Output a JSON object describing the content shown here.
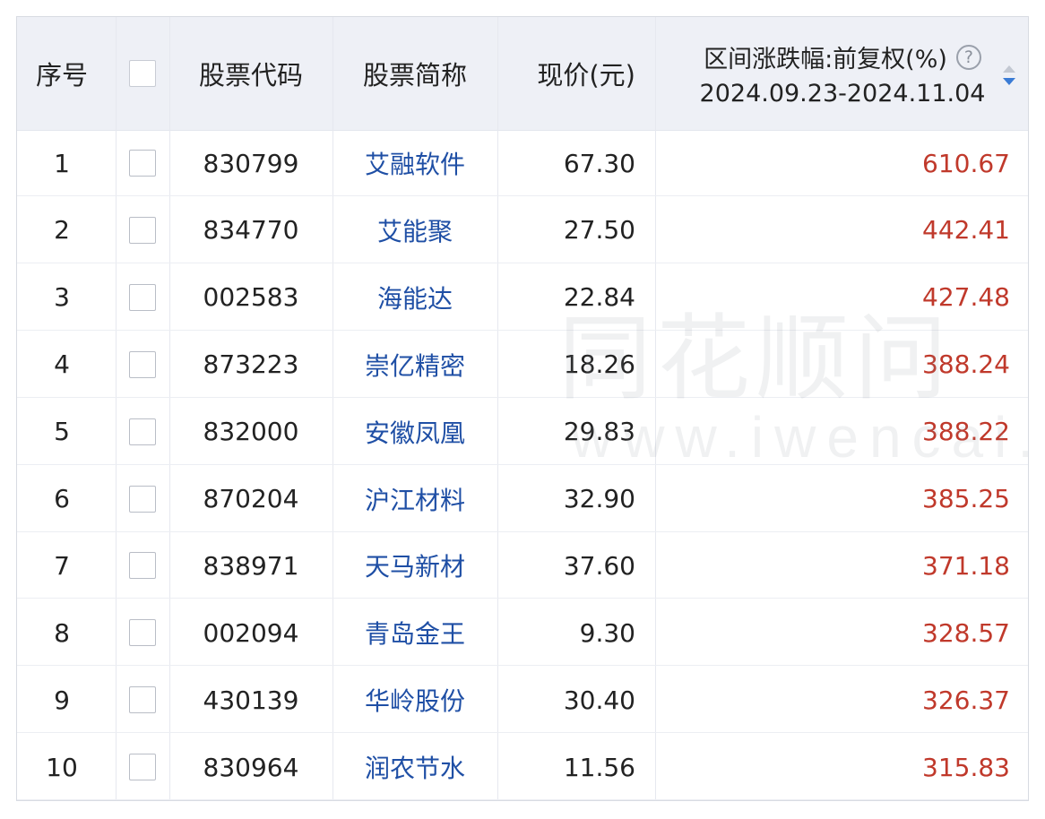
{
  "table": {
    "headers": {
      "num": "序号",
      "code": "股票代码",
      "name": "股票简称",
      "price": "现价(元)",
      "change_title": "区间涨跌幅:前复权(%)",
      "change_range": "2024.09.23-2024.11.04"
    },
    "rows": [
      {
        "num": "1",
        "code": "830799",
        "name": "艾融软件",
        "price": "67.30",
        "change": "610.67"
      },
      {
        "num": "2",
        "code": "834770",
        "name": "艾能聚",
        "price": "27.50",
        "change": "442.41"
      },
      {
        "num": "3",
        "code": "002583",
        "name": "海能达",
        "price": "22.84",
        "change": "427.48"
      },
      {
        "num": "4",
        "code": "873223",
        "name": "崇亿精密",
        "price": "18.26",
        "change": "388.24"
      },
      {
        "num": "5",
        "code": "832000",
        "name": "安徽凤凰",
        "price": "29.83",
        "change": "388.22"
      },
      {
        "num": "6",
        "code": "870204",
        "name": "沪江材料",
        "price": "32.90",
        "change": "385.25"
      },
      {
        "num": "7",
        "code": "838971",
        "name": "天马新材",
        "price": "37.60",
        "change": "371.18"
      },
      {
        "num": "8",
        "code": "002094",
        "name": "青岛金王",
        "price": "9.30",
        "change": "328.57"
      },
      {
        "num": "9",
        "code": "430139",
        "name": "华岭股份",
        "price": "30.40",
        "change": "326.37"
      },
      {
        "num": "10",
        "code": "830964",
        "name": "润农节水",
        "price": "11.56",
        "change": "315.83"
      }
    ]
  },
  "watermark": {
    "line1": "同花顺问",
    "line2": "www.iwencai.c"
  },
  "icons": {
    "help": "help-icon",
    "sort": "sort-icon"
  },
  "colors": {
    "header_bg": "#eef0f6",
    "stock_name": "#1f4fa5",
    "change_value": "#c0392b",
    "sort_active": "#3a7bd5"
  }
}
